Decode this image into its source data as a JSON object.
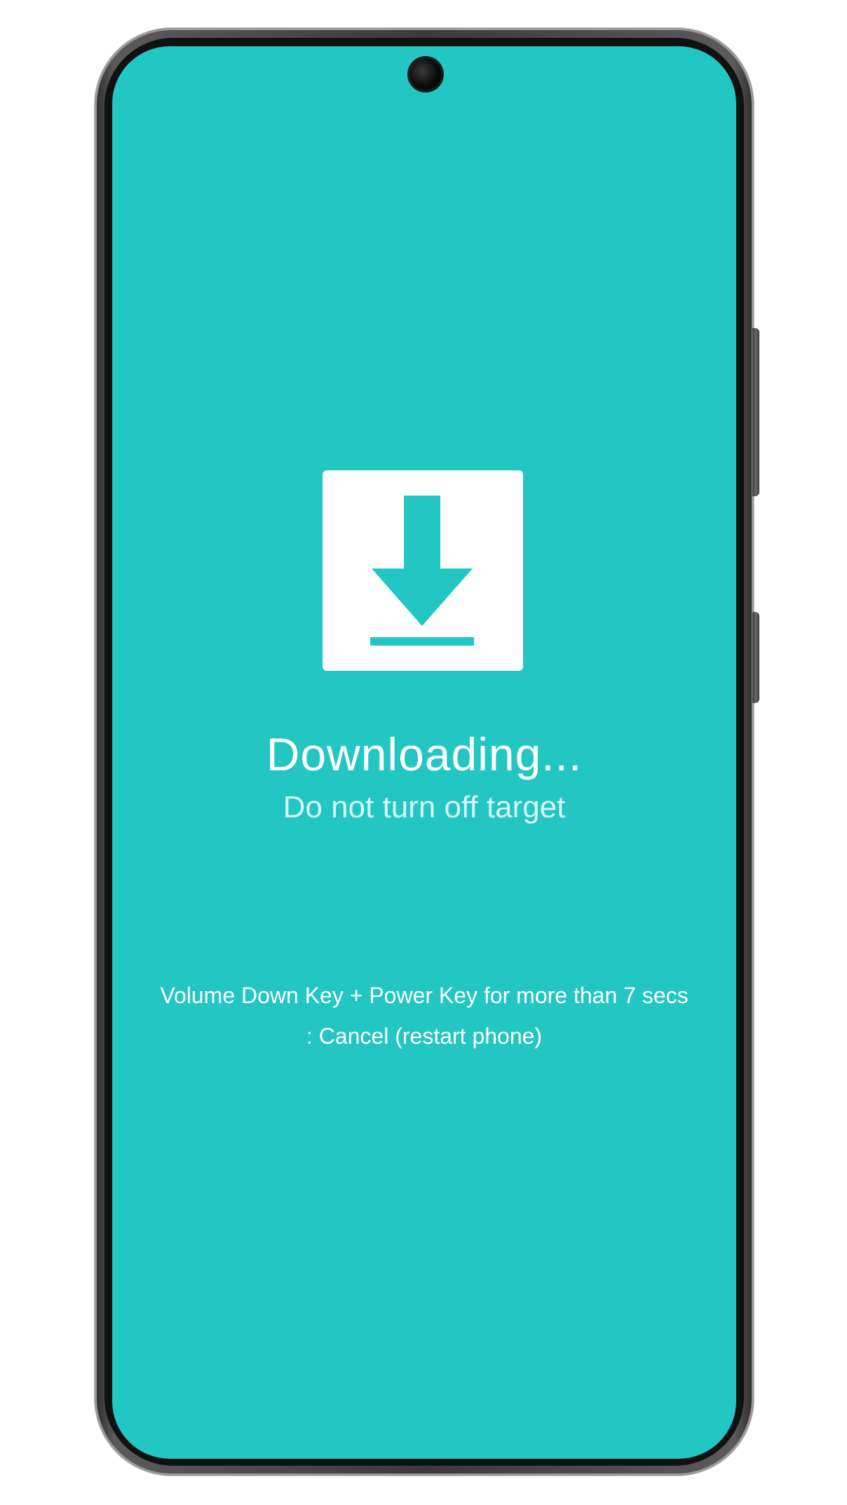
{
  "colors": {
    "screen_background": "#22c6c3",
    "icon_box": "#ffffff",
    "icon_glyph": "#22c6c3",
    "title_text": "#ffffff",
    "subtitle_text": "#d8f6f5"
  },
  "icon": {
    "name": "download-arrow-icon"
  },
  "status": {
    "title": "Downloading...",
    "subtitle": "Do not turn off target"
  },
  "instructions": {
    "line1": "Volume Down Key + Power Key for more than 7 secs",
    "line2": ": Cancel (restart phone)"
  }
}
